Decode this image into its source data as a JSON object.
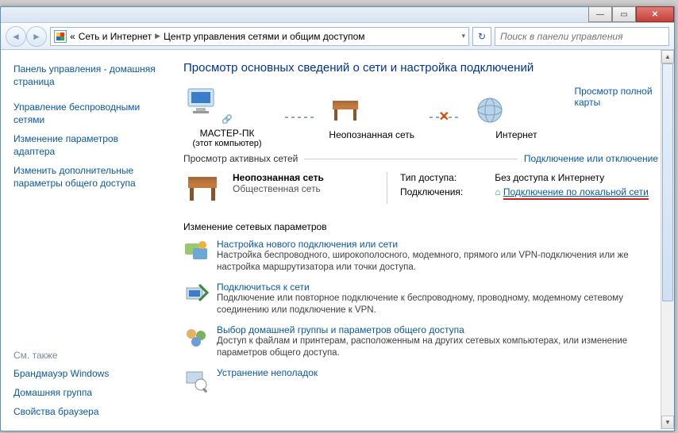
{
  "titlebar": {
    "min": "—",
    "max": "▭",
    "close": "✕"
  },
  "navbar": {
    "crumb_prefix": "«",
    "crumb1": "Сеть и Интернет",
    "crumb2": "Центр управления сетями и общим доступом",
    "search_placeholder": "Поиск в панели управления"
  },
  "sidebar": {
    "items": [
      "Панель управления - домашняя страница",
      "Управление беспроводными сетями",
      "Изменение параметров адаптера",
      "Изменить дополнительные параметры общего доступа"
    ],
    "see_also_hdr": "См. также",
    "see_also": [
      "Брандмауэр Windows",
      "Домашняя группа",
      "Свойства браузера"
    ]
  },
  "main": {
    "heading": "Просмотр основных сведений о сети и настройка подключений",
    "map": {
      "node1": {
        "label": "МАСТЕР-ПК",
        "sub": "(этот компьютер)"
      },
      "node2": {
        "label": "Неопознанная сеть"
      },
      "node3": {
        "label": "Интернет"
      },
      "full_map_link": "Просмотр полной карты"
    },
    "active_hdr": "Просмотр активных сетей",
    "active_right": "Подключение или отключение",
    "netblock": {
      "name": "Неопознанная сеть",
      "type": "Общественная сеть",
      "access_lbl": "Тип доступа:",
      "access_val": "Без доступа к Интернету",
      "conn_lbl": "Подключения:",
      "conn_val": "Подключение по локальной сети"
    },
    "params_hdr": "Изменение сетевых параметров",
    "tasks": [
      {
        "title": "Настройка нового подключения или сети",
        "desc": "Настройка беспроводного, широкополосного, модемного, прямого или VPN-подключения или же настройка маршрутизатора или точки доступа."
      },
      {
        "title": "Подключиться к сети",
        "desc": "Подключение или повторное подключение к беспроводному, проводному, модемному сетевому соединению или подключение к VPN."
      },
      {
        "title": "Выбор домашней группы и параметров общего доступа",
        "desc": "Доступ к файлам и принтерам, расположенным на других сетевых компьютерах, или изменение параметров общего доступа."
      },
      {
        "title": "Устранение неполадок",
        "desc": ""
      }
    ]
  }
}
